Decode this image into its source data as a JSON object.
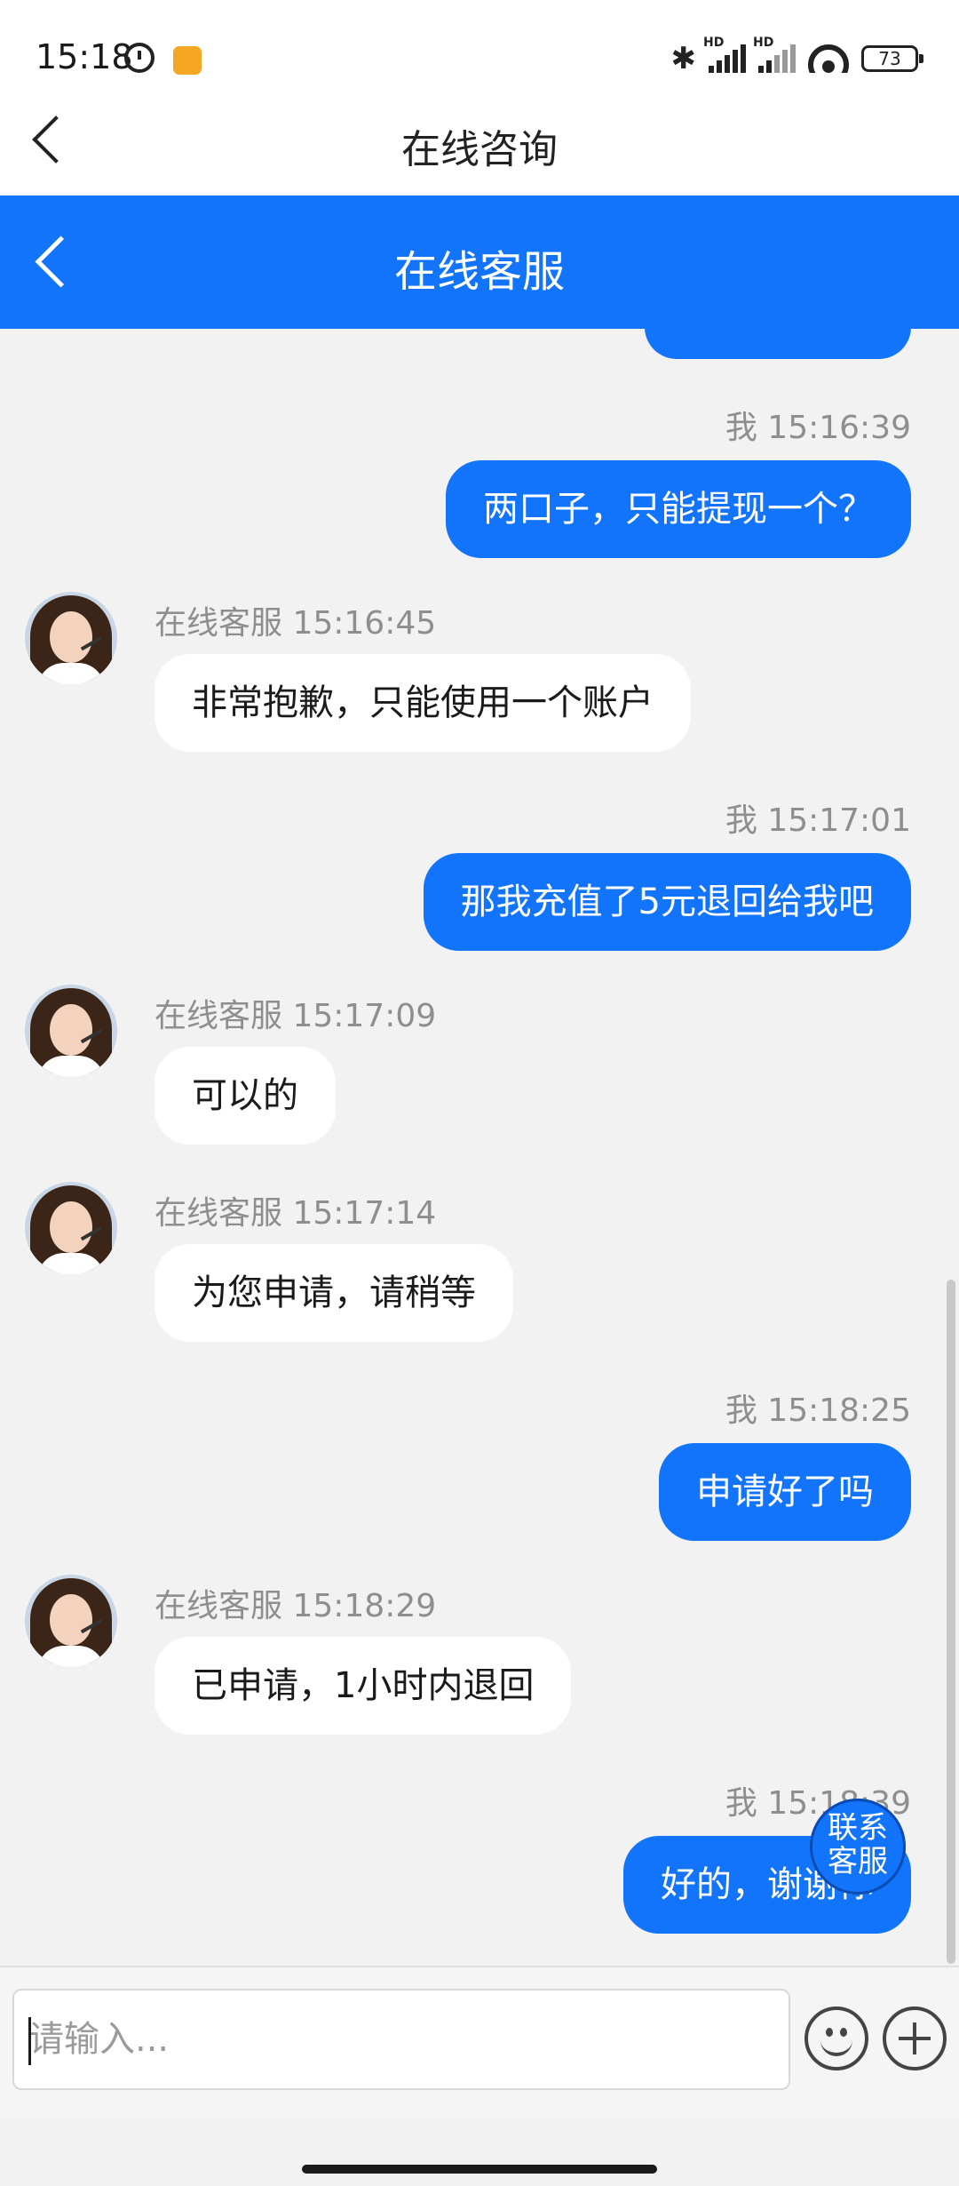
{
  "status_bar": {
    "time": "15:18",
    "battery": "73"
  },
  "outer_header": {
    "title": "在线咨询"
  },
  "chat_header": {
    "title": "在线客服"
  },
  "messages": [
    {
      "side": "out",
      "time": "我 15:16:39",
      "text": "两口子，只能提现一个？"
    },
    {
      "side": "in",
      "time": "在线客服 15:16:45",
      "text": "非常抱歉，只能使用一个账户"
    },
    {
      "side": "out",
      "time": "我 15:17:01",
      "text": "那我充值了5元退回给我吧"
    },
    {
      "side": "in",
      "time": "在线客服 15:17:09",
      "text": "可以的"
    },
    {
      "side": "in",
      "time": "在线客服 15:17:14",
      "text": "为您申请，请稍等"
    },
    {
      "side": "out",
      "time": "我 15:18:25",
      "text": "申请好了吗"
    },
    {
      "side": "in",
      "time": "在线客服 15:18:29",
      "text": "已申请，1小时内退回"
    },
    {
      "side": "out",
      "time": "我 15:18:39",
      "text": "好的，谢谢你"
    }
  ],
  "float_button": {
    "line1": "联系",
    "line2": "客服"
  },
  "input": {
    "placeholder": "请输入..."
  }
}
